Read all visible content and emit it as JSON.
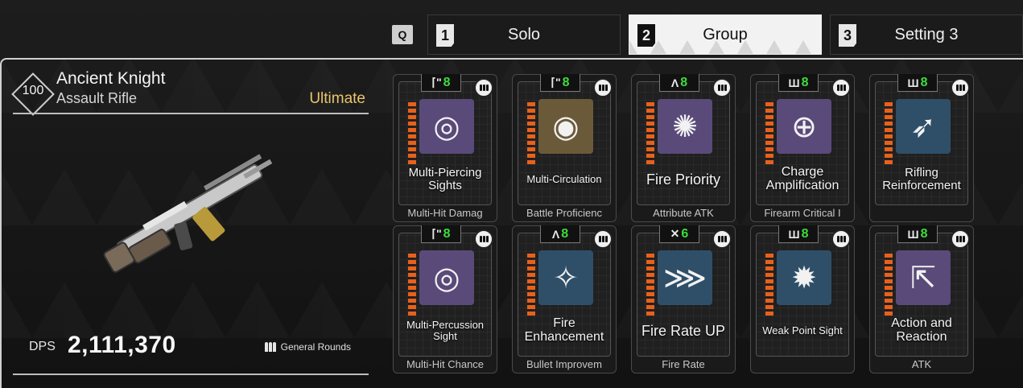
{
  "tabs": {
    "q_key": "Q",
    "items": [
      {
        "num": "1",
        "label": "Solo"
      },
      {
        "num": "2",
        "label": "Group"
      },
      {
        "num": "3",
        "label": "Setting 3"
      }
    ]
  },
  "weapon": {
    "level": "100",
    "name": "Ancient Knight",
    "type": "Assault Rifle",
    "rarity": "Ultimate",
    "dps_label": "DPS",
    "dps_value": "2,111,370",
    "ammo_type": "General Rounds"
  },
  "colors": {
    "rarity": "#e9c46a",
    "capacity_green": "#3ddc3d",
    "bar_orange": "#e8611c",
    "icon_purple": "#5a4a7a",
    "icon_blue": "#2f4f69",
    "icon_gold": "#6b5a3a"
  },
  "modules": [
    {
      "name": "Multi-Piercing Sights",
      "category": "Multi-Hit Damag",
      "capacity_symbol": "⌈\"",
      "capacity": "8",
      "icon": "crosshair-rotate-icon",
      "icon_bg": "purple",
      "name_size": "small"
    },
    {
      "name": "Multi-Circulation",
      "category": "Battle Proficienc",
      "capacity_symbol": "⌈\"",
      "capacity": "8",
      "icon": "circulation-icon",
      "icon_bg": "gold",
      "name_size": "xsmall"
    },
    {
      "name": "Fire Priority",
      "category": "Attribute ATK",
      "capacity_symbol": "Λ",
      "capacity": "8",
      "icon": "starburst-icon",
      "icon_bg": "purple",
      "name_size": "large"
    },
    {
      "name": "Charge Amplification",
      "category": "Firearm Critical I",
      "capacity_symbol": "Ш",
      "capacity": "8",
      "icon": "converge-icon",
      "icon_bg": "purple",
      "name_size": "medium"
    },
    {
      "name": "Rifling Reinforcement",
      "category": "",
      "capacity_symbol": "Ш",
      "capacity": "8",
      "icon": "bullet-up-icon",
      "icon_bg": "blue",
      "name_size": "small"
    },
    {
      "name": "Multi-Percussion Sight",
      "category": "Multi-Hit Chance",
      "capacity_symbol": "⌈\"",
      "capacity": "8",
      "icon": "percussion-icon",
      "icon_bg": "purple",
      "name_size": "xsmall"
    },
    {
      "name": "Fire Enhancement",
      "category": "Bullet Improvem",
      "capacity_symbol": "Λ",
      "capacity": "8",
      "icon": "fire-bullet-icon",
      "icon_bg": "blue",
      "name_size": "medium"
    },
    {
      "name": "Fire Rate UP",
      "category": "Fire Rate",
      "capacity_symbol": "✕",
      "capacity": "6",
      "icon": "bullets-icon",
      "icon_bg": "blue",
      "name_size": "large"
    },
    {
      "name": "Weak Point Sight",
      "category": "",
      "capacity_symbol": "Ш",
      "capacity": "8",
      "icon": "weakpoint-icon",
      "icon_bg": "blue",
      "name_size": "xsmall"
    },
    {
      "name": "Action and Reaction",
      "category": "ATK",
      "capacity_symbol": "Ш",
      "capacity": "8",
      "icon": "recoil-icon",
      "icon_bg": "purple",
      "name_size": "medium"
    }
  ]
}
